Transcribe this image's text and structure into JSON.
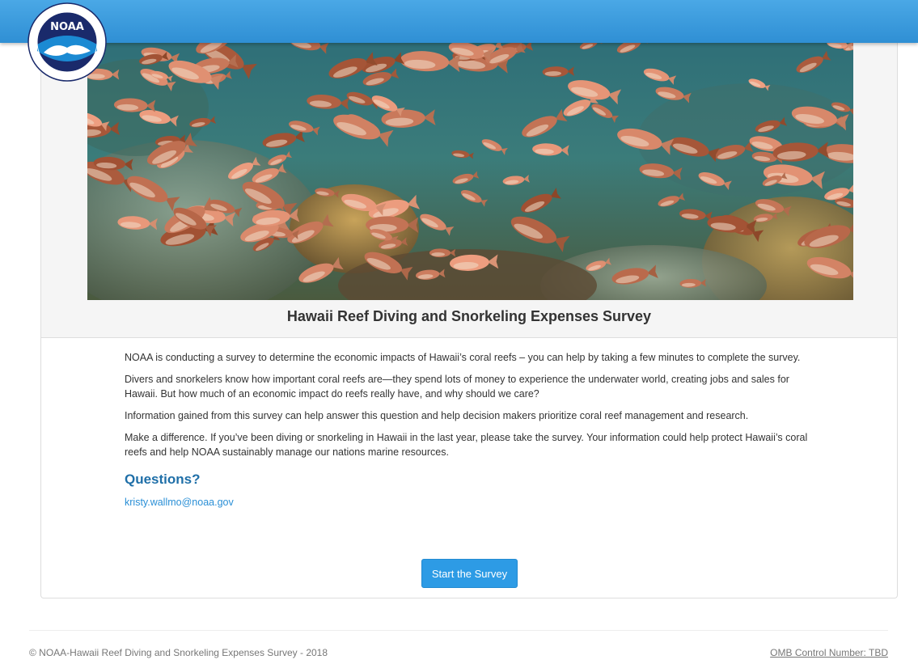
{
  "header": {
    "logo_label": "NOAA",
    "logo_alt": "NOAA seal",
    "brand_color": "#2f8fd4"
  },
  "hero": {
    "image_alt": "School of reef fish swimming over coral reef"
  },
  "panel": {
    "title": "Hawaii Reef Diving and Snorkeling Expenses Survey",
    "paragraphs": [
      "NOAA is conducting a survey to determine the economic impacts of Hawaii’s coral reefs – you can help by taking a few minutes to complete the survey.",
      "Divers and snorkelers know how important coral reefs are—they spend lots of money to experience the underwater world, creating jobs and sales for Hawaii. But how much of an economic impact do reefs really have, and why should we care?",
      "Information gained from this survey can help answer this question and help decision makers prioritize coral reef management and research.",
      "Make a difference. If you’ve been diving or snorkeling in Hawaii in the last year, please take the survey. Your information could help protect Hawaii’s coral reefs and help NOAA sustainably manage our nations marine resources."
    ],
    "questions_heading": "Questions?",
    "contact_email": "kristy.wallmo@noaa.gov",
    "start_button_label": "Start the Survey"
  },
  "footer": {
    "copyright": "© NOAA-Hawaii Reef Diving and Snorkeling Expenses Survey - 2018",
    "omb_label": "OMB Control Number: TBD"
  },
  "colors": {
    "accent": "#2d9be5",
    "link": "#2a8fd6",
    "heading": "#1f6fa8"
  }
}
